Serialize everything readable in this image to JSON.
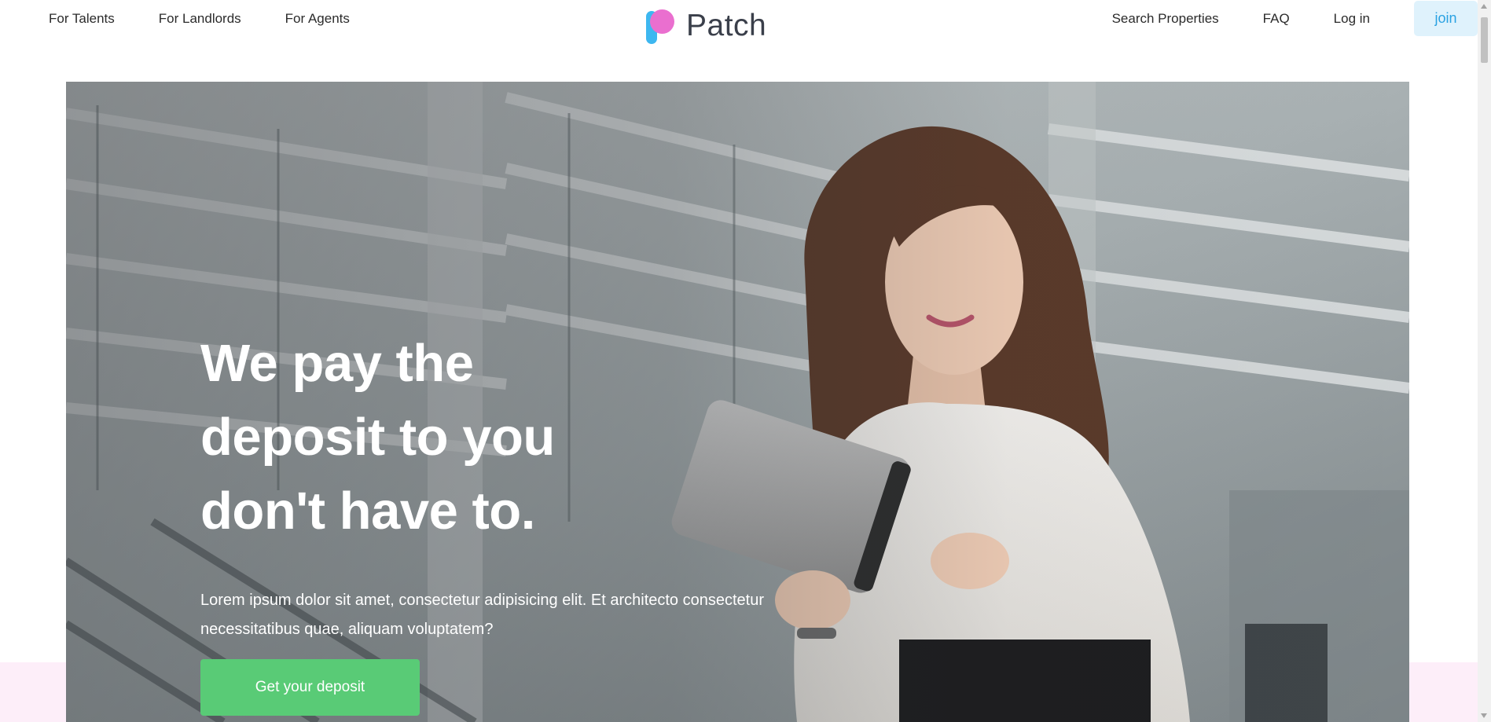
{
  "header": {
    "left_links": [
      "For Talents",
      "For Landlords",
      "For Agents"
    ],
    "brand_name": "Patch",
    "right_links": [
      "Search Properties",
      "FAQ",
      "Log in"
    ],
    "join_label": "join"
  },
  "hero": {
    "title": "We pay the deposit to you don't have to.",
    "text": "Lorem ipsum dolor sit amet, consectetur adipisicing elit. Et architecto consectetur necessitatibus quae, aliquam voluptatem?",
    "cta_label": "Get your deposit",
    "image": "woman-with-tablet-photo"
  },
  "colors": {
    "brand_blue": "#3db7f0",
    "brand_pink": "#ea6fcf",
    "join_bg": "#dff2fc",
    "join_text": "#2aa2e2",
    "cta_green": "#59cb76",
    "band_pink": "#fdeef9"
  }
}
